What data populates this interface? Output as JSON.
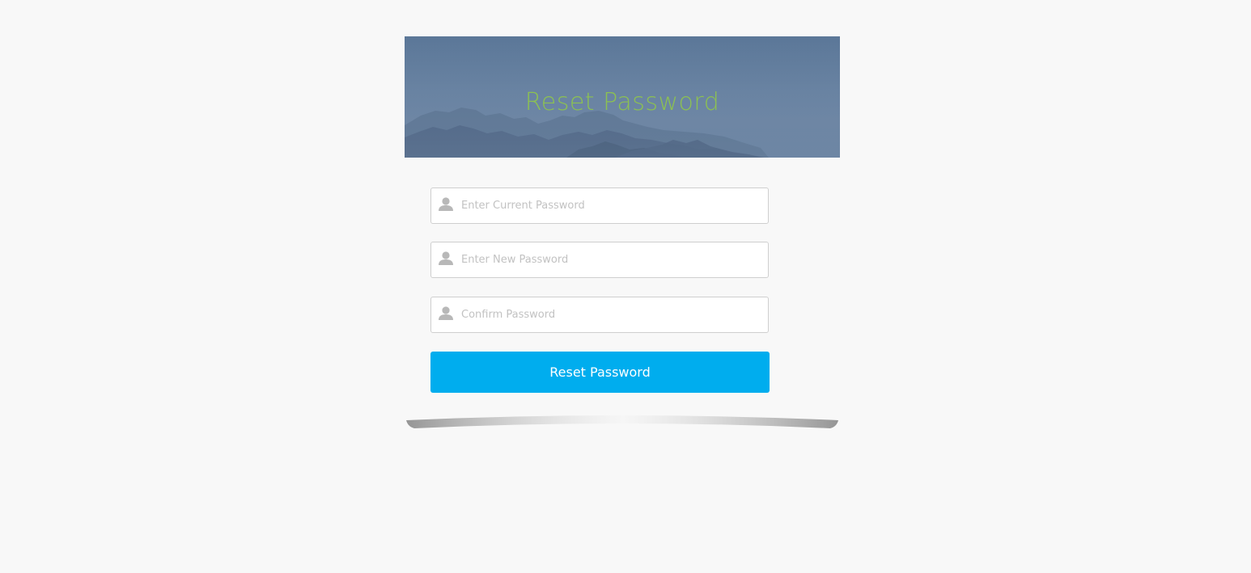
{
  "page": {
    "background": "#f8f8f8"
  },
  "banner": {
    "title": "Reset Password",
    "title_color": "#8cc152"
  },
  "form": {
    "fields": [
      {
        "placeholder": "Enter Current Password",
        "value": "",
        "icon": "user-icon"
      },
      {
        "placeholder": "Enter New Password",
        "value": "",
        "icon": "user-icon"
      },
      {
        "placeholder": "Confirm Password",
        "value": "",
        "icon": "user-icon"
      }
    ],
    "submit_label": "Reset Password",
    "submit_color": "#00adee"
  }
}
